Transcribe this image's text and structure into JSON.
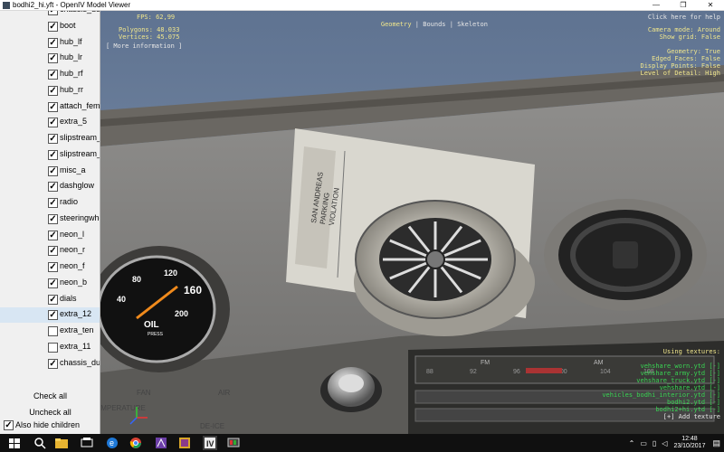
{
  "window": {
    "title": "bodhi2_hi.yft - OpenIV Model Viewer",
    "minimize": "—",
    "maximize": "❐",
    "close": "✕"
  },
  "left_panel": {
    "items": [
      {
        "label": "chassis_dummy",
        "checked": true
      },
      {
        "label": "boot",
        "checked": true
      },
      {
        "label": "hub_lf",
        "checked": true
      },
      {
        "label": "hub_lr",
        "checked": true
      },
      {
        "label": "hub_rf",
        "checked": true
      },
      {
        "label": "hub_rr",
        "checked": true
      },
      {
        "label": "attach_female",
        "checked": true
      },
      {
        "label": "extra_5",
        "checked": true
      },
      {
        "label": "slipstream_r",
        "checked": true
      },
      {
        "label": "slipstream_l",
        "checked": true
      },
      {
        "label": "misc_a",
        "checked": true
      },
      {
        "label": "dashglow",
        "checked": true
      },
      {
        "label": "radio",
        "checked": true
      },
      {
        "label": "steeringwheel",
        "checked": true
      },
      {
        "label": "neon_l",
        "checked": true
      },
      {
        "label": "neon_r",
        "checked": true
      },
      {
        "label": "neon_f",
        "checked": true
      },
      {
        "label": "neon_b",
        "checked": true
      },
      {
        "label": "dials",
        "checked": true
      },
      {
        "label": "extra_12",
        "checked": true,
        "selected": true
      },
      {
        "label": "extra_ten",
        "checked": false
      },
      {
        "label": "extra_11",
        "checked": false
      },
      {
        "label": "chassis_dummy",
        "checked": true
      }
    ],
    "check_all": "Check all",
    "uncheck_all": "Uncheck all",
    "also_hide_children": "Also hide children",
    "also_hide_checked": true
  },
  "viewport": {
    "stats": {
      "fps": "FPS: 62,99",
      "polygons": "Polygons: 48.033",
      "vertices": "Vertices: 45.075",
      "more_info": "[ More information ]"
    },
    "modes": {
      "geometry": "Geometry",
      "bounds": "Bounds",
      "skeleton": "Skeleton",
      "separator": "|"
    },
    "help": "Click here for help",
    "settings": [
      "Camera mode: Around",
      "Show grid: False",
      "",
      "Geometry: True",
      "Edged Faces: False",
      "Display Points: False",
      "Level of Detail: High"
    ],
    "textures": {
      "heading": "Using textures:",
      "files": [
        "vehshare_worn.ytd [-]",
        "vehshare_army.ytd [-]",
        "vehshare_truck.ytd [-]",
        "vehshare.ytd [-]",
        "vehicles_bodhi_interior.ytd [-]",
        "bodhi2.ytd [-]",
        "bodhi2+hi.ytd [-]"
      ],
      "add": "[+] Add texture"
    },
    "scene": {
      "gauge_ticks": [
        "40",
        "80",
        "120",
        "160",
        "200"
      ],
      "gauge_label": "OIL",
      "gauge_sublabel": "PRESS",
      "ticket_lines": [
        "SAN ANDREAS",
        "PARKING",
        "VIOLATION"
      ],
      "radio_bands": [
        "FM",
        "AM"
      ],
      "fm_freqs": [
        "88",
        "92",
        "96",
        "100",
        "104",
        "108"
      ],
      "dash_texts": [
        "FAN",
        "AIR",
        "DE-ICE",
        "TEMPERATURE"
      ]
    },
    "colors": {
      "hud_yellow": "#f0e68c",
      "hud_white": "#e6e6e6",
      "hud_green": "#39d353",
      "sky": "#6d7f97"
    }
  },
  "taskbar": {
    "time": "12:48",
    "date": "23/10/2017",
    "start_icon": "windows-start-icon",
    "apps": [
      "search-icon",
      "task-view-icon",
      "edge-icon",
      "chrome-icon",
      "file-explorer-icon",
      "photo-editor-icon",
      "winrar-icon",
      "openiv-icon",
      "monitor-app-icon"
    ]
  }
}
